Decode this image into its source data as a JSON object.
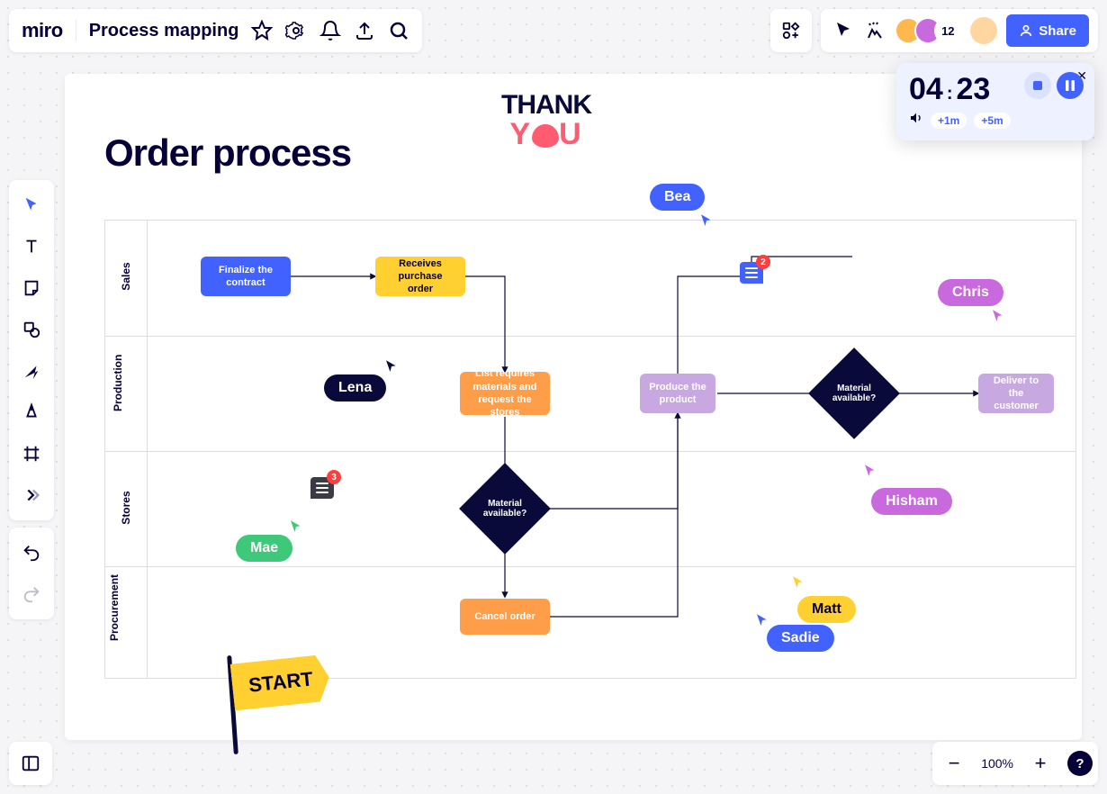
{
  "app": {
    "logo": "miro",
    "board_name": "Process mapping"
  },
  "share": {
    "label": "Share"
  },
  "avatar_overflow": "12",
  "timer": {
    "minutes": "04",
    "seconds": "23",
    "plus1": "+1m",
    "plus5": "+5m"
  },
  "zoom": {
    "pct": "100%"
  },
  "diagram": {
    "title": "Order process",
    "lanes": [
      "Sales",
      "Production",
      "Stores",
      "Procurement"
    ],
    "nodes": {
      "finalize": "Finalize the contract",
      "receives": "Receives purchase order",
      "list": "List requires materials and request the stores",
      "produce": "Produce the product",
      "deliver": "Deliver to the customer",
      "mat1": "Material available?",
      "mat2": "Material available?",
      "cancel": "Cancel order"
    }
  },
  "cursors": {
    "bea": "Bea",
    "chris": "Chris",
    "lena": "Lena",
    "mae": "Mae",
    "hisham": "Hisham",
    "matt": "Matt",
    "sadie": "Sadie"
  },
  "comments": {
    "left_count": "3",
    "top_count": "2"
  },
  "stickers": {
    "thank": "THANK",
    "you_1": "Y",
    "you_2": "U",
    "start": "START"
  }
}
